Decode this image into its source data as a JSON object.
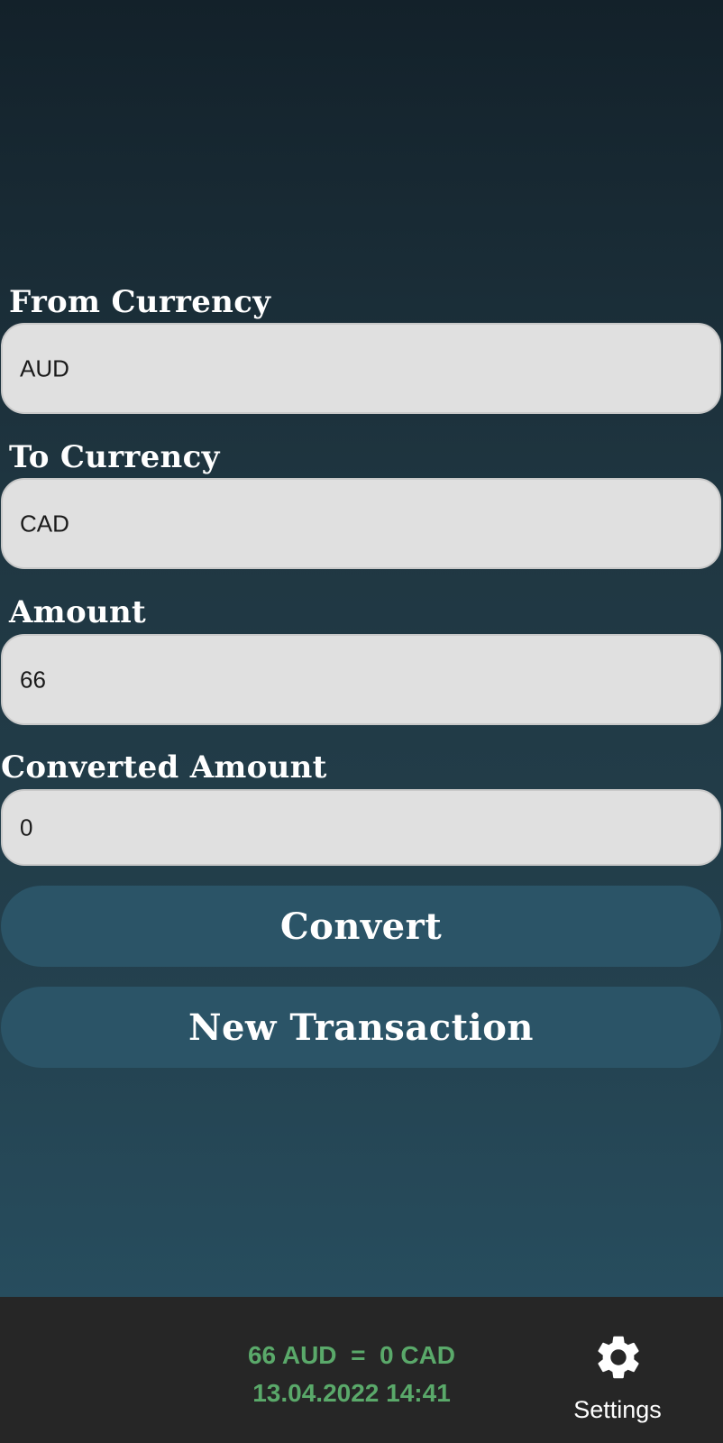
{
  "form": {
    "from_currency": {
      "label": "From Currency",
      "value": "AUD"
    },
    "to_currency": {
      "label": "To Currency",
      "value": "CAD"
    },
    "amount": {
      "label": "Amount",
      "value": "66"
    },
    "converted_amount": {
      "label": "Converted Amount",
      "value": "0"
    }
  },
  "actions": {
    "convert_label": "Convert",
    "new_transaction_label": "New Transaction"
  },
  "bottom_bar": {
    "summary_line": "66 AUD  =  0 CAD",
    "timestamp": "13.04.2022 14:41",
    "settings_label": "Settings",
    "settings_icon": "gear-icon"
  },
  "colors": {
    "background_top": "#13212a",
    "background_bottom": "#274d5e",
    "field_background": "#e0e0e0",
    "button_background": "#2b5467",
    "bottom_bar_background": "#262626",
    "summary_text": "#5aa96a"
  }
}
